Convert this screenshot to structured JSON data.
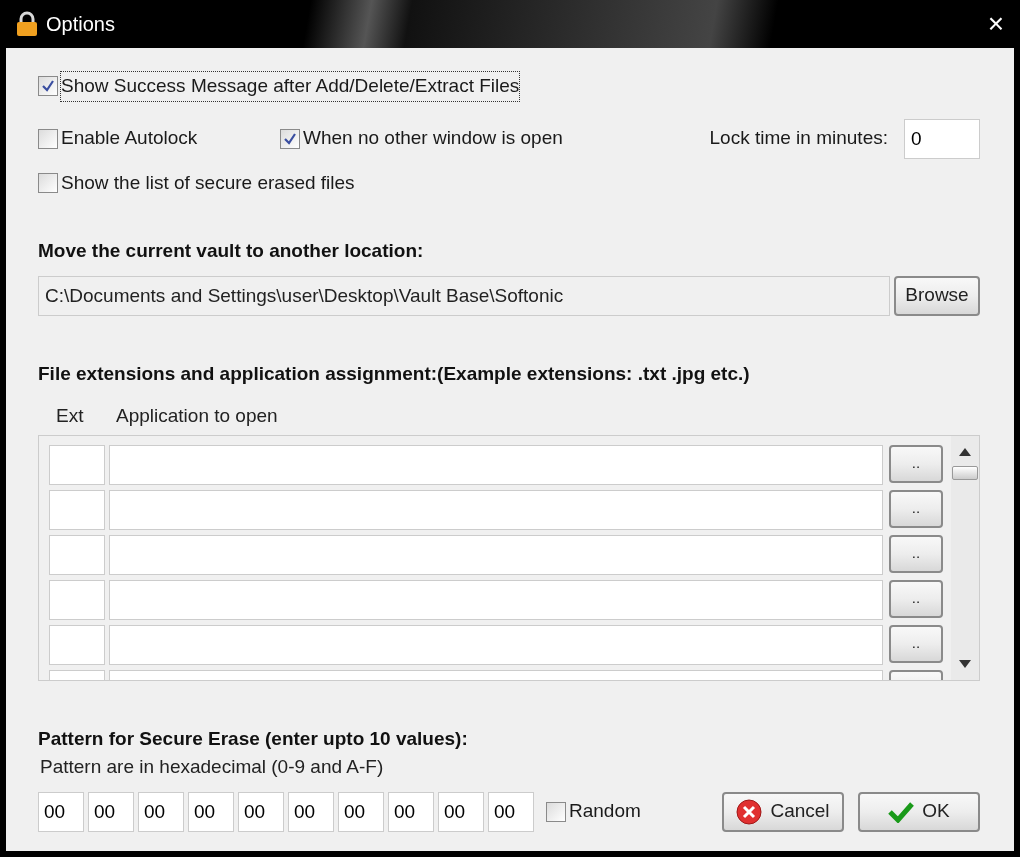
{
  "window": {
    "title": "Options",
    "close": "×"
  },
  "options": [
    {
      "label": "Show Success Message after Add/Delete/Extract Files",
      "checked": true,
      "focused": true
    }
  ],
  "autolock": {
    "enable": {
      "label": "Enable Autolock",
      "checked": false
    },
    "no_window": {
      "label": "When no other window is open",
      "checked": true
    },
    "lock_time_label": "Lock time in minutes:",
    "lock_time_value": "0"
  },
  "erased_list": {
    "label": "Show the list of secure erased files",
    "checked": false
  },
  "vault": {
    "heading": "Move the current vault to another location:",
    "path": "C:\\Documents and Settings\\user\\Desktop\\Vault Base\\Softonic",
    "browse": "Browse"
  },
  "extensions": {
    "heading": "File extensions and application assignment:(Example extensions: .txt .jpg etc.)",
    "columns": [
      "Ext",
      "Application to open"
    ],
    "rows": [
      {
        "button": ".."
      },
      {
        "button": ".."
      },
      {
        "button": ".."
      },
      {
        "button": ".."
      },
      {
        "button": ".."
      },
      {}
    ]
  },
  "pattern": {
    "heading": "Pattern for Secure Erase (enter upto 10 values):",
    "hint": "Pattern are in hexadecimal (0-9 and A-F)",
    "values": [
      "00",
      "00",
      "00",
      "00",
      "00",
      "00",
      "00",
      "00",
      "00",
      "00"
    ],
    "random": {
      "label": "Random",
      "checked": false
    }
  },
  "buttons": {
    "cancel": "Cancel",
    "ok": "OK"
  }
}
